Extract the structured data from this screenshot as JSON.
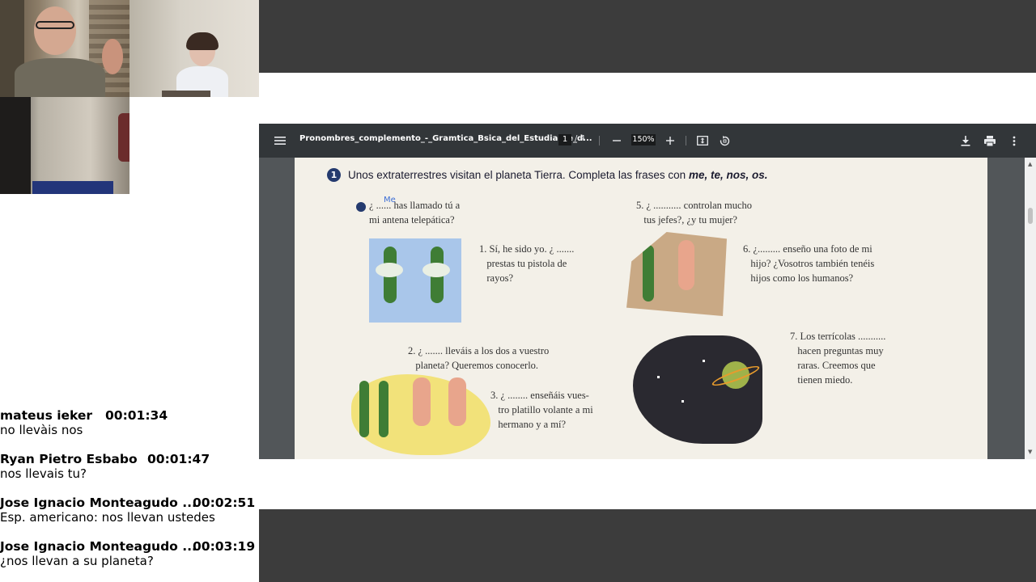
{
  "chat": {
    "messages": [
      {
        "name": "mateus ieker",
        "time": "00:01:34",
        "text": "no llevàis nos"
      },
      {
        "name": "Ryan Pietro Esbabo",
        "time": "00:01:47",
        "text": "nos llevais tu?"
      },
      {
        "name": "Jose Ignacio Monteagudo ...",
        "time": "00:02:51",
        "text": "Esp. americano: nos llevan ustedes"
      },
      {
        "name": "Jose Ignacio Monteagudo ...",
        "time": "00:03:19",
        "text": "¿nos llevan a su planeta?"
      }
    ]
  },
  "pdf": {
    "title": "Pronombres_complemento_-_Gramtica_Bsica_del_Estudiante_d...",
    "page_current": "1",
    "page_separator": "/",
    "page_total": "4",
    "zoom": "150%",
    "toolbar_icons": [
      "menu-icon",
      "zoom-out-icon",
      "zoom-in-icon",
      "fit-page-icon",
      "rotate-icon",
      "download-icon",
      "print-icon",
      "more-icon"
    ],
    "exercise": {
      "number": "1",
      "heading": "Unos extraterrestres visitan el planeta Tierra. Completa las frases con",
      "heading_words": "me, te, nos, os.",
      "example_answer": "Me",
      "items": {
        "ex_line1": "¿ ...... has llamado tú a",
        "ex_line2": "mi antena telepática?",
        "i1_line1": "1. Sí, he sido yo. ¿ .......",
        "i1_line2": "prestas tu pistola de",
        "i1_line3": "rayos?",
        "i2_line1": "2. ¿ ....... lleváis a los dos a vuestro",
        "i2_line2": "planeta? Queremos conocerlo.",
        "i3_line1": "3. ¿ ........ enseñáis vues-",
        "i3_line2": "tro platillo volante a mi",
        "i3_line3": "hermano y a mí?",
        "i5_line1": "5. ¿ ........... controlan mucho",
        "i5_line2": "tus jefes?, ¿y tu mujer?",
        "i6_line1": "6. ¿......... enseño una foto de mi",
        "i6_line2": "hijo? ¿Vosotros también tenéis",
        "i6_line3": "hijos como los humanos?",
        "i7_line1": "7. Los terrícolas ...........",
        "i7_line2": "hacen preguntas muy",
        "i7_line3": "raras. Creemos que",
        "i7_line4": "tienen miedo."
      }
    }
  },
  "colors": {
    "toolbar": "#323639",
    "viewer_bg": "#525659",
    "frame_bars": "#3c3c3c",
    "page": "#f3f0e8"
  }
}
